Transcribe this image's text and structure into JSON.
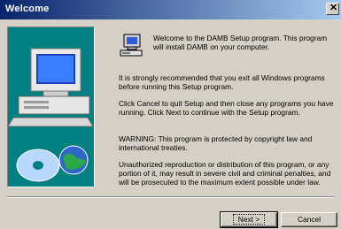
{
  "window": {
    "title": "Welcome"
  },
  "intro": "Welcome to the DAMB Setup program.  This program will install DAMB on your computer.",
  "paragraphs": [
    "It is strongly recommended that you exit all Windows programs before running this Setup program.",
    "Click Cancel to quit Setup and then close any programs you have running.  Click Next to continue with the Setup program.",
    "WARNING: This program is protected by copyright law and international treaties.",
    "Unauthorized reproduction or distribution of this program, or any portion of it, may result in severe civil and criminal penalties, and will be prosecuted to the maximum extent possible under law."
  ],
  "buttons": {
    "next": "Next >",
    "cancel": "Cancel"
  },
  "icons": {
    "close": "close-icon",
    "setup": "setup-computer-icon",
    "art": "computer-with-disc-illustration"
  }
}
